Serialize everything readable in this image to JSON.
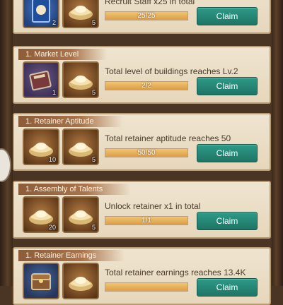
{
  "colors": {
    "claim_button": "#23806f",
    "progress_fill": "#e6ab57",
    "card_bg": "#ebdcc3",
    "title_banner": "#96643f"
  },
  "cards": [
    {
      "title": "",
      "description": "Recruit Staff x25 in total",
      "progress_text": "25/25",
      "progress": 1.0,
      "claim_label": "Claim",
      "rewards": [
        {
          "icon": "staff-card-icon",
          "qty": "2"
        },
        {
          "icon": "gold-ingot-icon",
          "qty": "5"
        }
      ]
    },
    {
      "title": "1. Market Level",
      "description": "Total level of buildings reaches Lv.2",
      "progress_text": "2/2",
      "progress": 1.0,
      "claim_label": "Claim",
      "rewards": [
        {
          "icon": "book-icon",
          "qty": "1"
        },
        {
          "icon": "gold-ingot-icon",
          "qty": "5"
        }
      ]
    },
    {
      "title": "1. Retainer Aptitude",
      "description": "Total retainer aptitude reaches 50",
      "progress_text": "50/50",
      "progress": 1.0,
      "claim_label": "Claim",
      "rewards": [
        {
          "icon": "gold-ingot-icon",
          "qty": "10"
        },
        {
          "icon": "gold-ingot-icon",
          "qty": "5"
        }
      ]
    },
    {
      "title": "1. Assembly of Talents",
      "description": "Unlock  retainer x1 in total",
      "progress_text": "1/1",
      "progress": 1.0,
      "claim_label": "Claim",
      "rewards": [
        {
          "icon": "gold-ingot-icon",
          "qty": "20"
        },
        {
          "icon": "gold-ingot-icon",
          "qty": "5"
        }
      ]
    },
    {
      "title": "1. Retainer Earnings",
      "description": "Total retainer earnings reaches 13.4K",
      "progress_text": "",
      "progress": 1.0,
      "claim_label": "Claim",
      "rewards": [
        {
          "icon": "chest-icon",
          "qty": ""
        },
        {
          "icon": "gold-ingot-icon",
          "qty": ""
        }
      ]
    }
  ]
}
